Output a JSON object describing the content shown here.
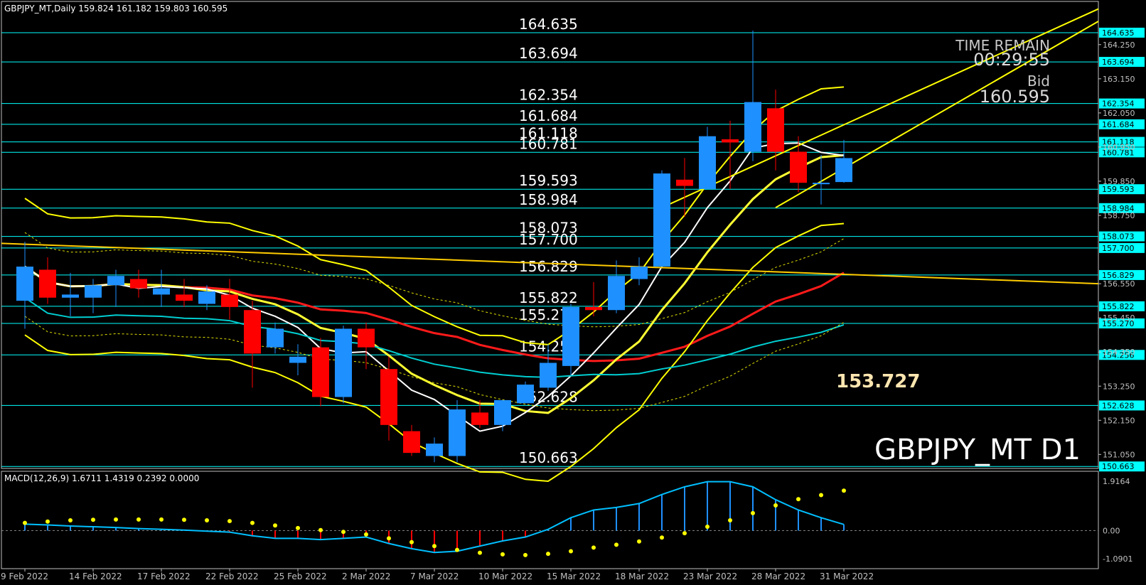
{
  "header": {
    "main": "GBPJPY_MT,Daily  159.824 161.182 159.803 160.595",
    "macd": "MACD(12,26,9) 1.6711 1.4319 0.2392 0.0000"
  },
  "watermark": "GBPJPY_MT D1",
  "time_remain": {
    "label": "TIME REMAIN",
    "value": "00:29:55"
  },
  "bid": {
    "label": "Bid",
    "value": "160.595"
  },
  "low_marker": "153.727",
  "levels": [
    "164.635",
    "163.694",
    "162.354",
    "161.684",
    "161.118",
    "160.781",
    "159.593",
    "158.984",
    "158.073",
    "157.700",
    "156.829",
    "155.822",
    "155.270",
    "154.256",
    "152.628",
    "150.663"
  ],
  "price_axis": [
    "164.250",
    "163.150",
    "162.050",
    "160.950",
    "159.850",
    "158.750",
    "156.550",
    "155.450",
    "154.350",
    "153.250",
    "152.150",
    "151.050"
  ],
  "macd_axis": [
    "1.9164",
    "0.00",
    "-1.0901"
  ],
  "date_axis": [
    "9 Feb 2022",
    "14 Feb 2022",
    "17 Feb 2022",
    "22 Feb 2022",
    "25 Feb 2022",
    "2 Mar 2022",
    "7 Mar 2022",
    "10 Mar 2022",
    "15 Mar 2022",
    "18 Mar 2022",
    "23 Mar 2022",
    "28 Mar 2022",
    "31 Mar 2022"
  ],
  "colors": {
    "bull": "#1e90ff",
    "bear": "#ff0000",
    "level": "#00ffff",
    "bb": "#ffff00",
    "ma_red": "#ff1a1a",
    "macd_line": "#00bfff",
    "signal": "#ffff00"
  },
  "chart_data": {
    "type": "candlestick",
    "ylim": [
      150.6,
      165.55
    ],
    "candles": [
      {
        "o": 156.0,
        "h": 157.9,
        "l": 155.1,
        "c": 157.1
      },
      {
        "o": 157.0,
        "h": 157.4,
        "l": 155.9,
        "c": 156.1
      },
      {
        "o": 156.1,
        "h": 156.9,
        "l": 155.5,
        "c": 156.2
      },
      {
        "o": 156.1,
        "h": 156.7,
        "l": 155.6,
        "c": 156.5
      },
      {
        "o": 156.5,
        "h": 157.0,
        "l": 155.8,
        "c": 156.8
      },
      {
        "o": 156.7,
        "h": 157.0,
        "l": 156.1,
        "c": 156.4
      },
      {
        "o": 156.2,
        "h": 157.0,
        "l": 155.8,
        "c": 156.4
      },
      {
        "o": 156.2,
        "h": 156.7,
        "l": 155.8,
        "c": 156.0
      },
      {
        "o": 155.9,
        "h": 156.5,
        "l": 155.7,
        "c": 156.3
      },
      {
        "o": 156.2,
        "h": 156.7,
        "l": 155.4,
        "c": 155.8
      },
      {
        "o": 155.7,
        "h": 156.0,
        "l": 153.2,
        "c": 154.3
      },
      {
        "o": 154.5,
        "h": 155.3,
        "l": 154.3,
        "c": 155.1
      },
      {
        "o": 154.0,
        "h": 154.6,
        "l": 153.6,
        "c": 154.2
      },
      {
        "o": 154.5,
        "h": 154.8,
        "l": 152.6,
        "c": 152.9
      },
      {
        "o": 152.9,
        "h": 155.2,
        "l": 152.7,
        "c": 155.1
      },
      {
        "o": 155.1,
        "h": 155.3,
        "l": 153.8,
        "c": 154.5
      },
      {
        "o": 153.8,
        "h": 154.2,
        "l": 151.5,
        "c": 152.0
      },
      {
        "o": 151.8,
        "h": 152.0,
        "l": 151.0,
        "c": 151.1
      },
      {
        "o": 151.0,
        "h": 151.6,
        "l": 150.8,
        "c": 151.4
      },
      {
        "o": 151.0,
        "h": 152.8,
        "l": 150.8,
        "c": 152.5
      },
      {
        "o": 152.4,
        "h": 152.8,
        "l": 151.9,
        "c": 152.0
      },
      {
        "o": 152.0,
        "h": 152.8,
        "l": 151.8,
        "c": 152.8
      },
      {
        "o": 152.7,
        "h": 153.4,
        "l": 152.7,
        "c": 153.3
      },
      {
        "o": 153.2,
        "h": 154.6,
        "l": 153.1,
        "c": 154.0
      },
      {
        "o": 153.9,
        "h": 155.9,
        "l": 153.6,
        "c": 155.8
      },
      {
        "o": 155.8,
        "h": 156.6,
        "l": 155.5,
        "c": 155.7
      },
      {
        "o": 155.7,
        "h": 157.3,
        "l": 155.6,
        "c": 156.8
      },
      {
        "o": 156.7,
        "h": 157.4,
        "l": 156.5,
        "c": 157.1
      },
      {
        "o": 157.1,
        "h": 160.2,
        "l": 157.1,
        "c": 160.1
      },
      {
        "o": 159.9,
        "h": 160.6,
        "l": 158.7,
        "c": 159.7
      },
      {
        "o": 159.6,
        "h": 161.6,
        "l": 159.6,
        "c": 161.3
      },
      {
        "o": 161.2,
        "h": 161.8,
        "l": 159.6,
        "c": 161.1
      },
      {
        "o": 160.8,
        "h": 164.7,
        "l": 160.5,
        "c": 162.4
      },
      {
        "o": 162.2,
        "h": 162.8,
        "l": 160.2,
        "c": 160.8
      },
      {
        "o": 160.8,
        "h": 161.3,
        "l": 159.5,
        "c": 159.8
      },
      {
        "o": 159.8,
        "h": 160.7,
        "l": 159.1,
        "c": 159.8
      },
      {
        "o": 159.824,
        "h": 161.182,
        "l": 159.803,
        "c": 160.595
      }
    ],
    "macd": {
      "ylim": [
        -1.0901,
        1.9164
      ],
      "histogram": [
        0.25,
        0.22,
        0.18,
        0.15,
        0.12,
        0.08,
        0.05,
        0.02,
        -0.02,
        -0.06,
        -0.2,
        -0.3,
        -0.3,
        -0.35,
        -0.3,
        -0.25,
        -0.5,
        -0.7,
        -0.85,
        -0.8,
        -0.6,
        -0.4,
        -0.25,
        0.05,
        0.5,
        0.8,
        0.9,
        1.05,
        1.4,
        1.7,
        1.9,
        1.9,
        1.7,
        1.2,
        0.8,
        0.5,
        0.24
      ],
      "signal": [
        0.3,
        0.35,
        0.4,
        0.42,
        0.43,
        0.43,
        0.43,
        0.42,
        0.4,
        0.37,
        0.3,
        0.2,
        0.1,
        0.02,
        -0.05,
        -0.15,
        -0.3,
        -0.45,
        -0.6,
        -0.75,
        -0.86,
        -0.92,
        -0.95,
        -0.9,
        -0.8,
        -0.66,
        -0.55,
        -0.42,
        -0.27,
        -0.1,
        0.15,
        0.4,
        0.68,
        0.98,
        1.22,
        1.38,
        1.55
      ]
    }
  }
}
